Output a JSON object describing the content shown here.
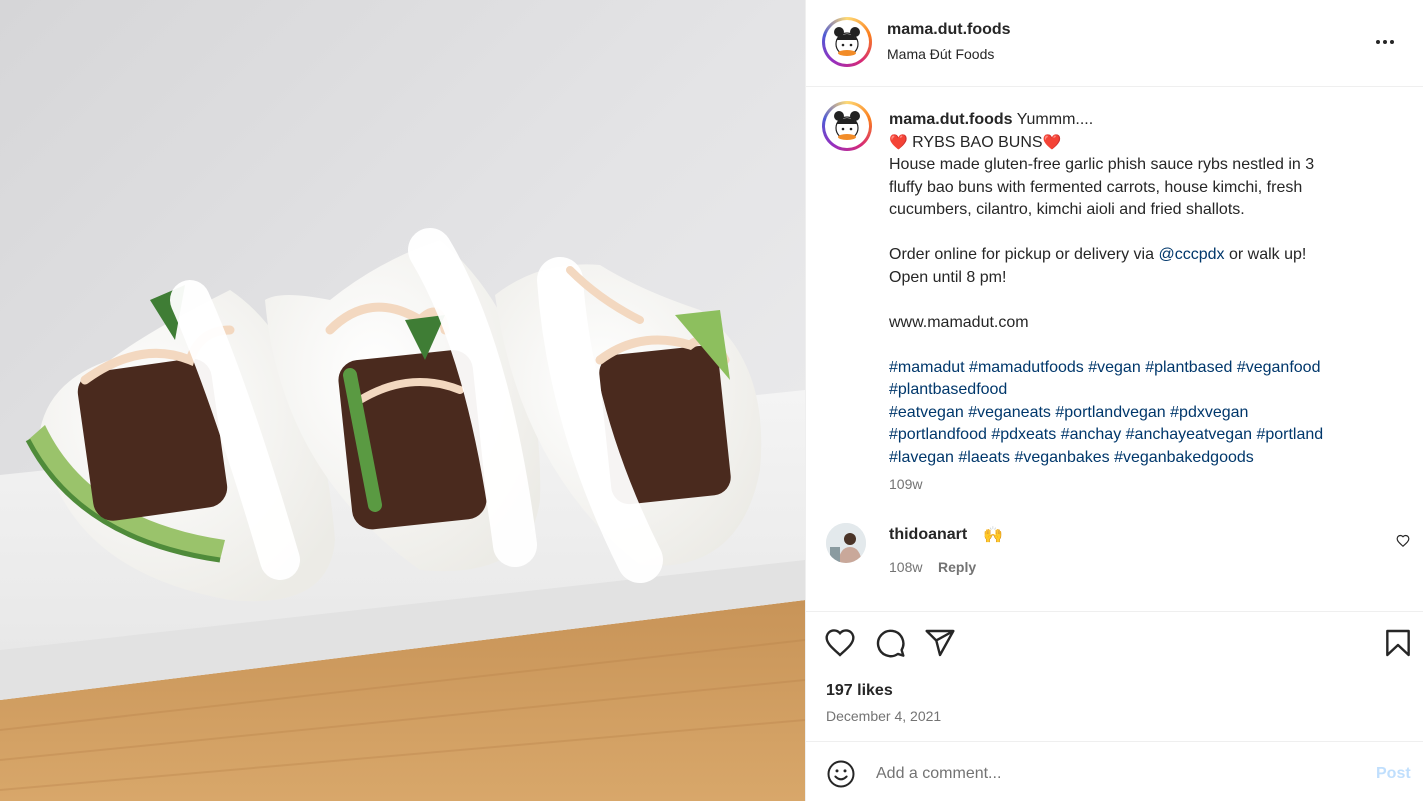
{
  "post": {
    "username": "mama.dut.foods",
    "account_subtitle": "Mama Đút Foods",
    "caption": {
      "username": "mama.dut.foods",
      "opening": "Yummm....",
      "heart_left": "❤️",
      "title": "RYBS BAO BUNS",
      "heart_right": "❤️",
      "description_lines": [
        "House made gluten-free garlic phish sauce rybs nestled in 3",
        "fluffy bao buns with fermented carrots, house kimchi, fresh",
        "cucumbers, cilantro, kimchi aioli and fried shallots."
      ],
      "order_prefix": "Order online for pickup or delivery via",
      "order_mention": "@cccpdx",
      "order_suffix": "or walk up!",
      "hours": "Open until 8 pm!",
      "website": "www.mamadut.com",
      "hashtag_lines": [
        [
          "#mamadut",
          "#mamadutfoods",
          "#vegan",
          "#plantbased",
          "#veganfood"
        ],
        [
          "#plantbasedfood"
        ],
        [
          "#eatvegan",
          "#veganeats",
          "#portlandvegan",
          "#pdxvegan"
        ],
        [
          "#portlandfood",
          "#pdxeats",
          "#anchay",
          "#anchayeatvegan",
          "#portland"
        ],
        [
          "#lavegan",
          "#laeats",
          "#veganbakes",
          "#veganbakedgoods"
        ]
      ],
      "time_ago": "109w"
    },
    "comments": [
      {
        "username": "thidoanart",
        "text": "🙌",
        "time_ago": "108w",
        "reply_label": "Reply"
      }
    ],
    "likes": "197 likes",
    "date": "December 4, 2021",
    "add_comment_placeholder": "Add a comment...",
    "post_label": "Post"
  },
  "icons": {
    "more": "more-options-icon",
    "like": "heart-icon",
    "comment": "comment-bubble-icon",
    "share": "paper-plane-icon",
    "save": "bookmark-icon",
    "emoji": "smiley-icon"
  },
  "colors": {
    "link": "#00376b",
    "muted": "#737373",
    "post_disabled": "#c0dffd",
    "heart": "#e0245e"
  }
}
